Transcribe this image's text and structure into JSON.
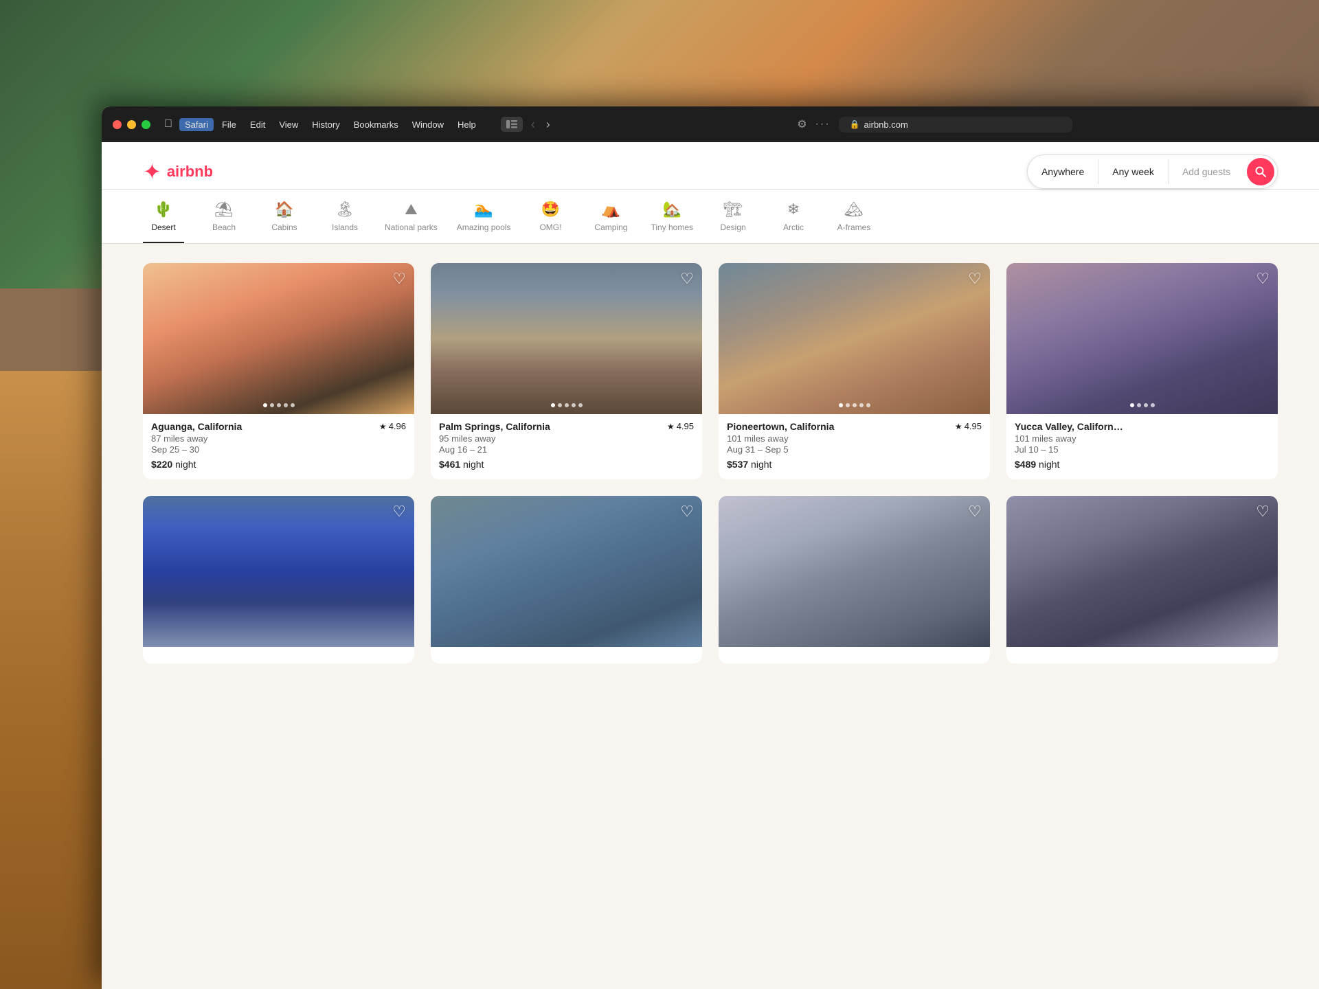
{
  "browser": {
    "url": "airbnb.com",
    "menu_items": [
      "Safari",
      "File",
      "Edit",
      "View",
      "History",
      "Bookmarks",
      "Window",
      "Help"
    ]
  },
  "header": {
    "logo_text": "airbnb",
    "search": {
      "anywhere_label": "Anywhere",
      "any_week_label": "Any week",
      "add_guests_label": "Add guests"
    }
  },
  "categories": [
    {
      "id": "desert",
      "label": "Desert",
      "icon": "🌵",
      "active": true
    },
    {
      "id": "beach",
      "label": "Beach",
      "icon": "⛱"
    },
    {
      "id": "cabins",
      "label": "Cabins",
      "icon": "🏠"
    },
    {
      "id": "islands",
      "label": "Islands",
      "icon": "🏝"
    },
    {
      "id": "national_parks",
      "label": "National parks",
      "icon": "⛰"
    },
    {
      "id": "amazing_pools",
      "label": "Amazing pools",
      "icon": "🏊"
    },
    {
      "id": "omg",
      "label": "OMG!",
      "icon": "🤩"
    },
    {
      "id": "camping",
      "label": "Camping",
      "icon": "⛺"
    },
    {
      "id": "tiny_homes",
      "label": "Tiny homes",
      "icon": "🏡"
    },
    {
      "id": "design",
      "label": "Design",
      "icon": "🏗"
    },
    {
      "id": "arctic",
      "label": "Arctic",
      "icon": "❄"
    },
    {
      "id": "a_frames",
      "label": "A-frames",
      "icon": "🏔"
    }
  ],
  "listings": [
    {
      "id": 1,
      "location": "Aguanga, California",
      "distance": "87 miles away",
      "dates": "Sep 25 – 30",
      "price": "$220",
      "rating": "4.96",
      "img_class": "img-desert1",
      "dot_count": 5,
      "active_dot": 1
    },
    {
      "id": 2,
      "location": "Palm Springs, California",
      "distance": "95 miles away",
      "dates": "Aug 16 – 21",
      "price": "$461",
      "rating": "4.95",
      "img_class": "img-desert2",
      "dot_count": 5,
      "active_dot": 1
    },
    {
      "id": 3,
      "location": "Pioneertown, California",
      "distance": "101 miles away",
      "dates": "Aug 31 – Sep 5",
      "price": "$537",
      "rating": "4.95",
      "img_class": "img-desert3",
      "dot_count": 5,
      "active_dot": 1
    },
    {
      "id": 4,
      "location": "Yucca Valley, California",
      "distance": "101 miles away",
      "dates": "Jul 10 – 15",
      "price": "$489",
      "rating": "",
      "img_class": "img-desert4",
      "dot_count": 4,
      "active_dot": 1
    },
    {
      "id": 5,
      "location": "",
      "distance": "",
      "dates": "",
      "price": "",
      "rating": "",
      "img_class": "img-bottom1",
      "dot_count": 0,
      "active_dot": 0
    },
    {
      "id": 6,
      "location": "",
      "distance": "",
      "dates": "",
      "price": "",
      "rating": "",
      "img_class": "img-bottom2",
      "dot_count": 0,
      "active_dot": 0
    },
    {
      "id": 7,
      "location": "",
      "distance": "",
      "dates": "",
      "price": "",
      "rating": "",
      "img_class": "img-bottom3",
      "dot_count": 0,
      "active_dot": 0
    },
    {
      "id": 8,
      "location": "",
      "distance": "",
      "dates": "",
      "price": "",
      "rating": "",
      "img_class": "img-bottom4",
      "dot_count": 0,
      "active_dot": 0
    }
  ],
  "labels": {
    "night": "night",
    "star": "★"
  }
}
